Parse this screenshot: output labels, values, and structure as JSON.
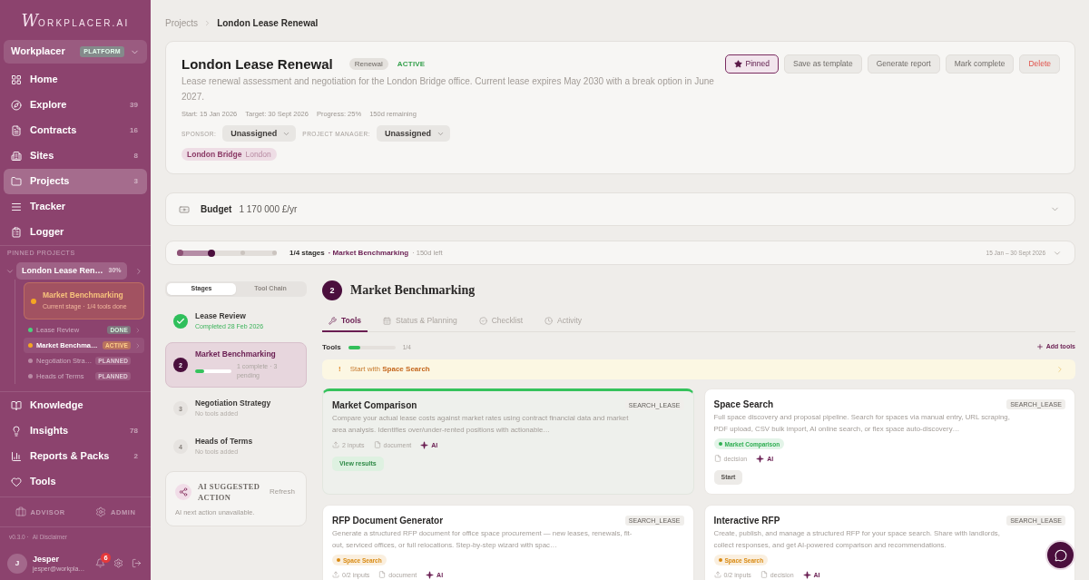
{
  "sidebar": {
    "logo": "WORKPLACER.AI",
    "workspace": {
      "name": "Workplacer",
      "badge": "PLATFORM"
    },
    "nav": [
      {
        "label": "Home",
        "selected": false
      },
      {
        "label": "Explore",
        "count": "39",
        "selected": false
      },
      {
        "label": "Contracts",
        "count": "16",
        "selected": false
      },
      {
        "label": "Sites",
        "count": "8",
        "selected": false
      },
      {
        "label": "Projects",
        "count": "3",
        "selected": true
      },
      {
        "label": "Tracker",
        "selected": false
      },
      {
        "label": "Logger",
        "selected": false
      }
    ],
    "pinned_label": "PINNED PROJECTS",
    "pinned_project": {
      "name": "London Lease Ren…",
      "progress": "30%",
      "expanded": true,
      "current_stage": {
        "name": "Market Benchmarking",
        "detail": "Current stage · 1/4 tools done"
      },
      "stages": [
        {
          "name": "Lease Review",
          "status": "DONE",
          "kind": "done",
          "color": "#4cd07d",
          "selected": false
        },
        {
          "name": "Market Benchma…",
          "status": "ACTIVE",
          "kind": "active",
          "color": "#f5a623",
          "selected": true
        },
        {
          "name": "Negotiation Stra…",
          "status": "PLANNED",
          "kind": "planned",
          "color": "#b98aa4",
          "selected": false
        },
        {
          "name": "Heads of Terms",
          "status": "PLANNED",
          "kind": "planned",
          "color": "#b98aa4",
          "selected": false
        }
      ]
    },
    "nav_secondary": [
      {
        "label": "Knowledge",
        "selected": false
      },
      {
        "label": "Insights",
        "count": "78",
        "selected": false
      },
      {
        "label": "Reports & Packs",
        "count": "2",
        "selected": false
      },
      {
        "label": "Tools",
        "selected": false
      }
    ],
    "roles": [
      {
        "label": "ADVISOR"
      },
      {
        "label": "ADMIN"
      }
    ],
    "footer": {
      "version": "v0.3.0 ·",
      "link": "AI Disclaimer"
    },
    "user": {
      "initial": "J",
      "name": "Jesper",
      "email": "jesper@workpla…",
      "notifications": "6"
    }
  },
  "breadcrumb": [
    "Projects",
    "London Lease Renewal"
  ],
  "project": {
    "title": "London Lease Renewal",
    "type": "Renewal",
    "status": "ACTIVE",
    "pinned": true,
    "actions": [
      {
        "label": "Pinned",
        "kind": "pin"
      },
      {
        "label": "Save as template",
        "kind": "default"
      },
      {
        "label": "Generate report",
        "kind": "default"
      },
      {
        "label": "Mark complete",
        "kind": "default"
      },
      {
        "label": "Delete",
        "kind": "danger"
      }
    ],
    "description": "Lease renewal assessment and negotiation for the London Bridge office. Current lease expires May 2030 with a break option in June 2027.",
    "meta": [
      "Start: 15 Jan 2026",
      "Target: 30 Sept 2026",
      "Progress: 25%",
      "150d remaining"
    ],
    "sponsor": {
      "label": "SPONSOR:",
      "value": "Unassigned"
    },
    "manager": {
      "label": "PROJECT MANAGER:",
      "value": "Unassigned"
    },
    "location": {
      "name": "London Bridge",
      "city": "London"
    }
  },
  "budget": {
    "label": "Budget",
    "value": "1 170 000 £/yr",
    "expanded": false
  },
  "timeline": {
    "level": 0.33,
    "stages_done": "1/4 stages",
    "current": "· Market Benchmarking",
    "remaining": "· 150d left",
    "range": "15 Jan – 30 Sept 2026",
    "expanded": false
  },
  "stage_panel": {
    "tabs": [
      {
        "label": "Stages",
        "selected": true
      },
      {
        "label": "Tool Chain",
        "selected": false
      }
    ],
    "stages": [
      {
        "name": "Lease Review",
        "detail": "Completed 28 Feb 2026",
        "kind": "done",
        "selected": false
      },
      {
        "number": "2",
        "name": "Market Benchmarking",
        "detail": "1 complete · 3 pending",
        "kind": "active",
        "selected": true,
        "level": 0.25
      },
      {
        "number": "3",
        "name": "Negotiation Strategy",
        "detail": "No tools added",
        "kind": "planned",
        "selected": false
      },
      {
        "number": "4",
        "name": "Heads of Terms",
        "detail": "No tools added",
        "kind": "planned",
        "selected": false
      }
    ],
    "ai_card": {
      "title": "AI SUGGESTED ACTION",
      "action": "Refresh",
      "message": "AI next action unavailable."
    }
  },
  "stage_detail": {
    "number": "2",
    "title": "Market Benchmarking",
    "tabs": [
      {
        "label": "Tools",
        "selected": true
      },
      {
        "label": "Status & Planning",
        "selected": false
      },
      {
        "label": "Checklist",
        "selected": false
      },
      {
        "label": "Activity",
        "selected": false
      }
    ],
    "tools": {
      "label": "Tools",
      "level": 0.25,
      "reading": "1/4",
      "add": "Add tools"
    },
    "banner": {
      "mark": "!",
      "text": "Start with **Space Search**"
    },
    "cards": [
      {
        "title": "Market Comparison",
        "tag": "SEARCH_LEASE",
        "completed": true,
        "description": "Compare your actual lease costs against market rates using contract financial data and market area analysis. Identifies over/under-rented positions with actionable…",
        "meta": [
          {
            "kind": "inputs",
            "label": "2 inputs"
          },
          {
            "kind": "output",
            "label": "document"
          },
          {
            "kind": "ai",
            "label": "AI"
          }
        ],
        "button": "View results"
      },
      {
        "title": "Space Search",
        "tag": "SEARCH_LEASE",
        "completed": false,
        "description": "Full space discovery and proposal pipeline. Search for spaces via manual entry, URL scraping, PDF upload, CSV bulk import, AI online search, or flex space auto-discovery…",
        "dependency": {
          "label": "Market Comparison",
          "color": "#2fae52"
        },
        "meta": [
          {
            "kind": "output",
            "label": "decision"
          },
          {
            "kind": "ai",
            "label": "AI"
          }
        ],
        "button": "Start"
      },
      {
        "title": "RFP Document Generator",
        "tag": "SEARCH_LEASE",
        "completed": false,
        "description": "Generate a structured RFP document for office space procurement — new leases, renewals, fit-out, serviced offices, or full relocations. Step-by-step wizard with spac…",
        "dependency": {
          "label": "Space Search",
          "color": "#d98a12"
        },
        "meta": [
          {
            "kind": "inputs",
            "label": "0/2 inputs"
          },
          {
            "kind": "output",
            "label": "document"
          },
          {
            "kind": "ai",
            "label": "AI"
          }
        ]
      },
      {
        "title": "Interactive RFP",
        "tag": "SEARCH_LEASE",
        "completed": false,
        "description": "Create, publish, and manage a structured RFP for your space search. Share with landlords, collect responses, and get AI-powered comparison and recommendations.",
        "dependency": {
          "label": "Space Search",
          "color": "#d98a12"
        },
        "meta": [
          {
            "kind": "inputs",
            "label": "0/2 inputs"
          },
          {
            "kind": "output",
            "label": "decision"
          },
          {
            "kind": "ai",
            "label": "AI"
          }
        ]
      }
    ]
  }
}
